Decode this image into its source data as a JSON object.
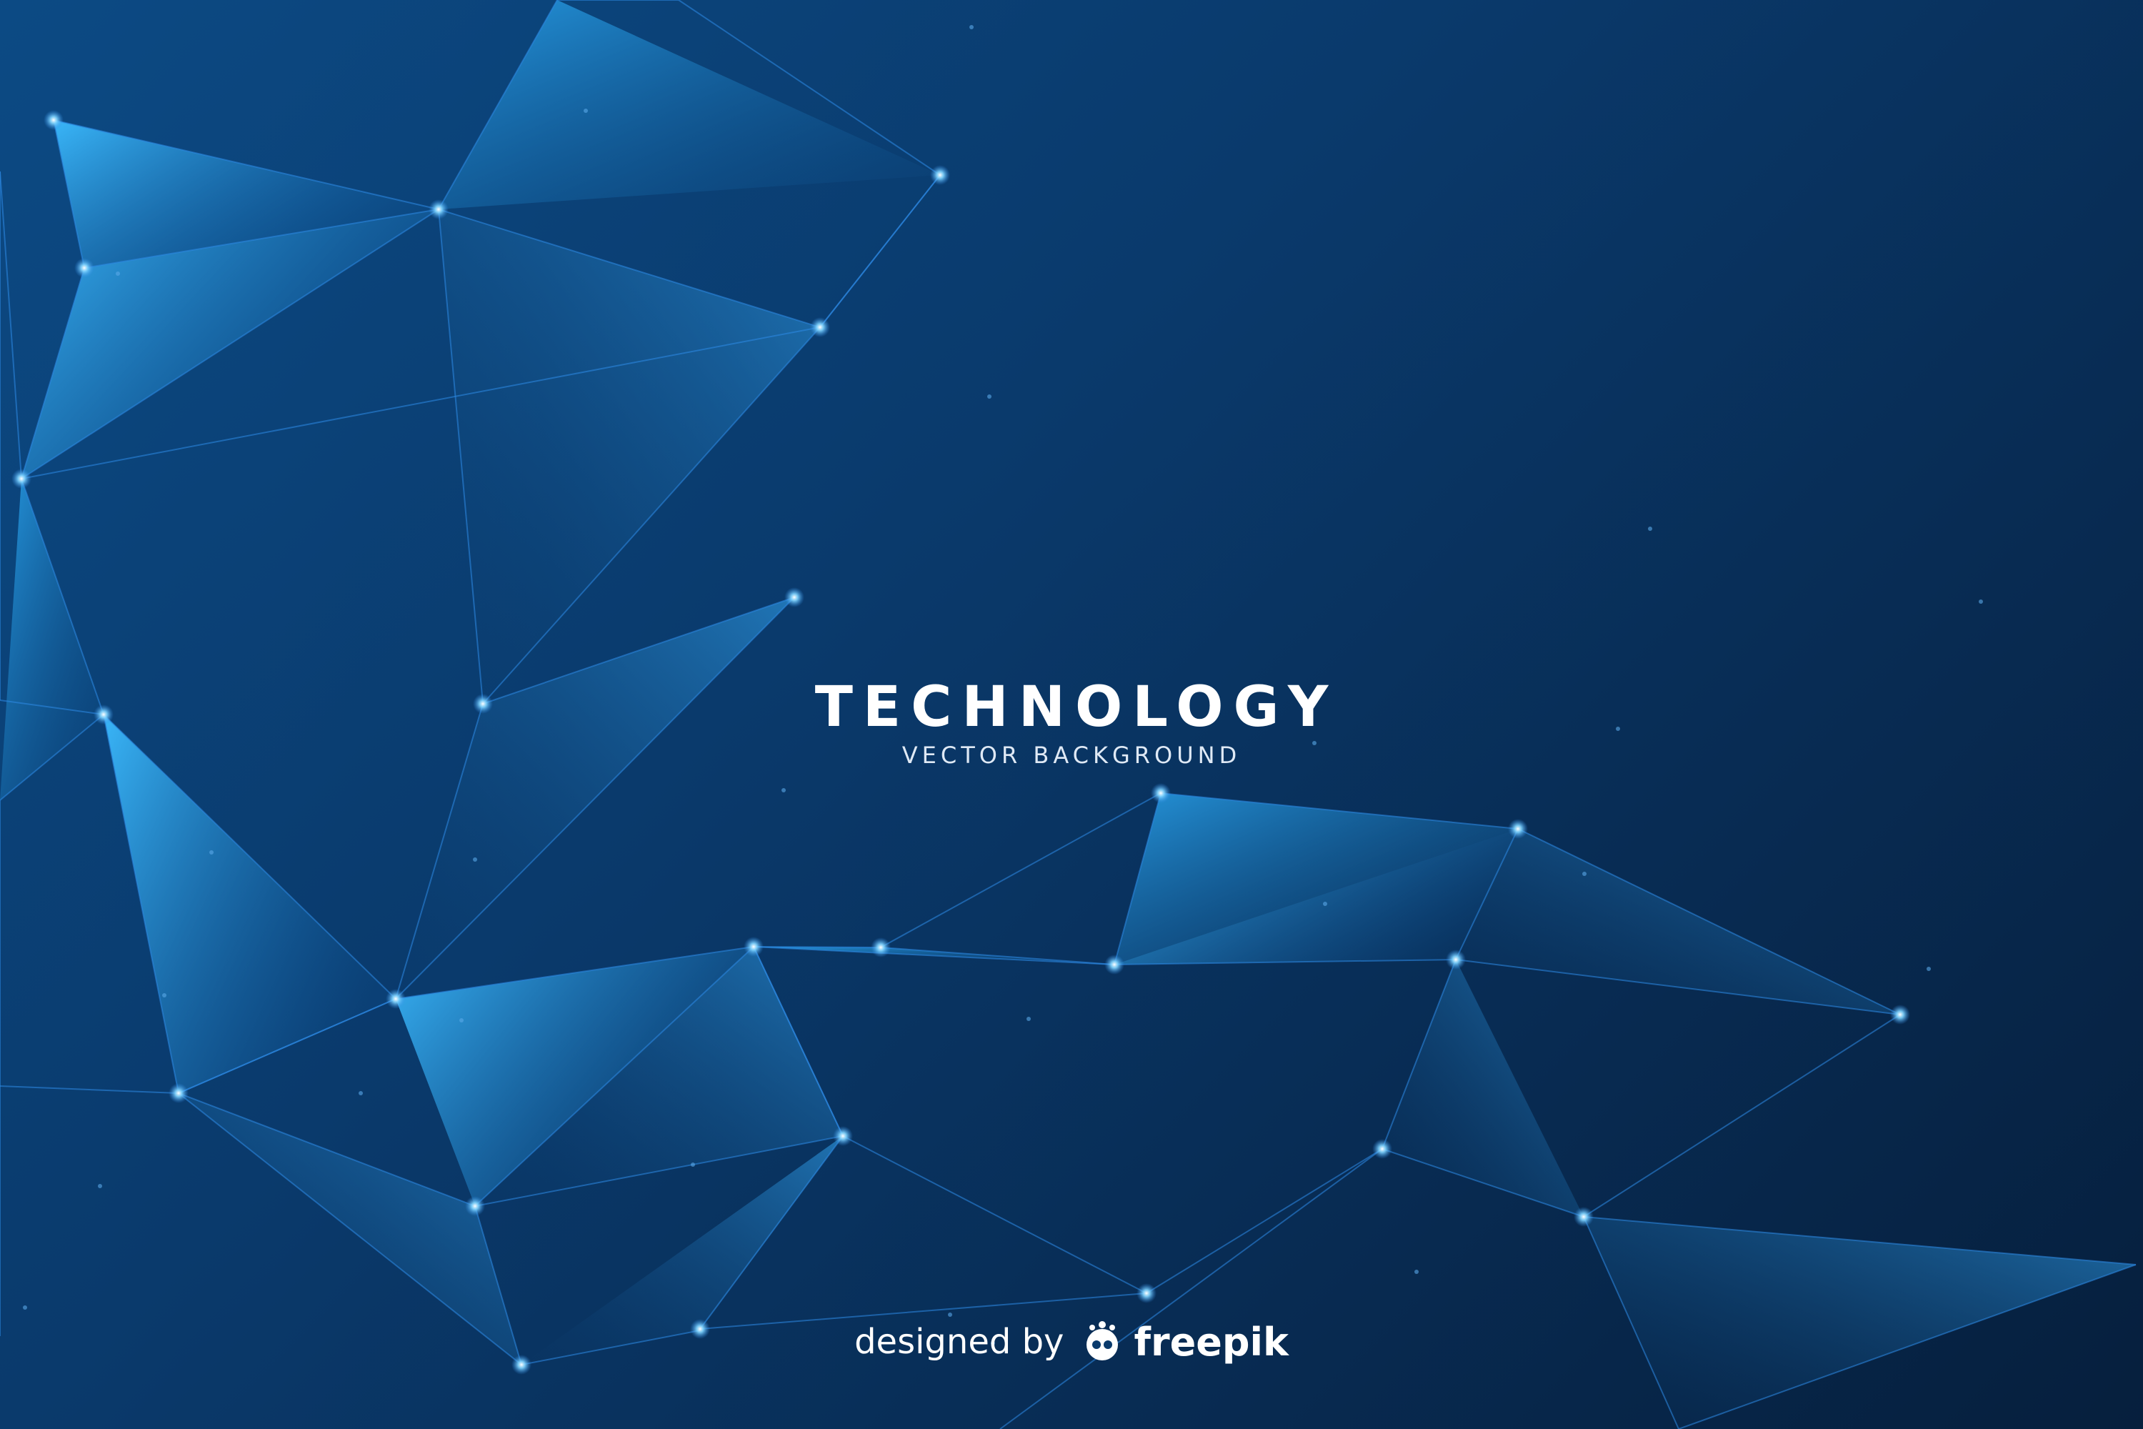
{
  "title": "TECHNOLOGY",
  "subtitle": "VECTOR BACKGROUND",
  "credit": {
    "prefix": "designed by",
    "brand": "freepik",
    "icon": "freepik-logo-icon"
  },
  "colors": {
    "background_light": "#0c4a84",
    "background_dark": "#061f3d",
    "facet_highlight": "#37b7ff",
    "node_glow": "#7fd4ff",
    "line": "#2e8ae6"
  }
}
